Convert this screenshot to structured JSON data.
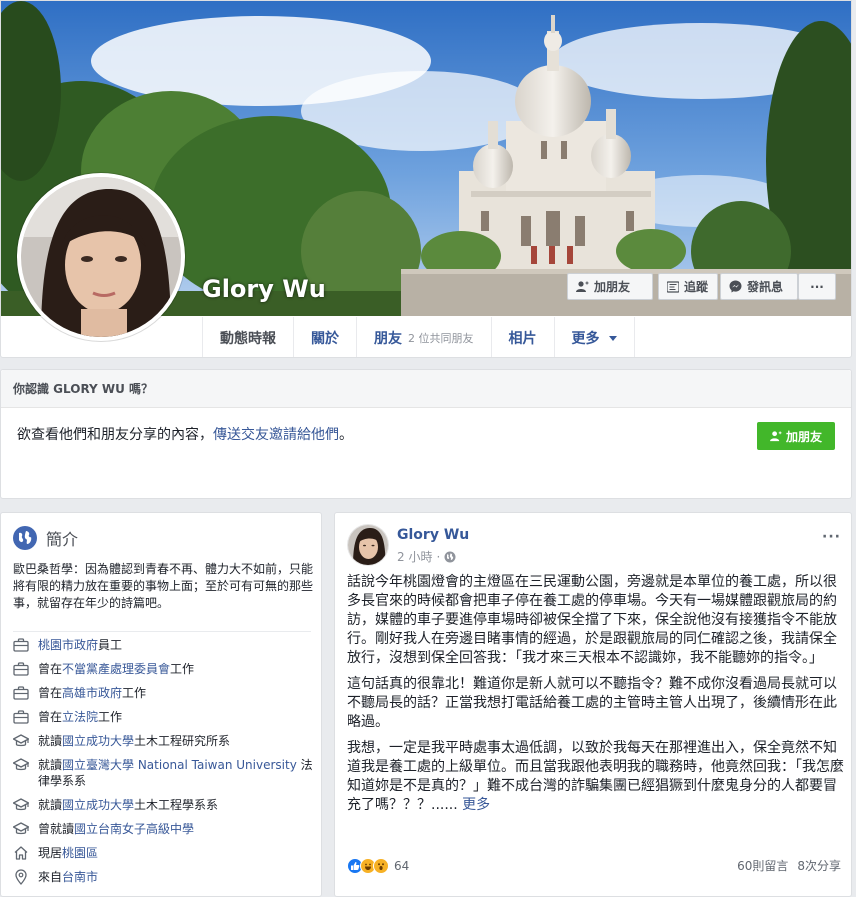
{
  "profile": {
    "name": "Glory Wu",
    "cover_buttons": {
      "add_friend": "加朋友",
      "follow": "追蹤",
      "message": "發訊息",
      "more": "···"
    }
  },
  "nav": {
    "tabs": [
      {
        "label": "動態時報"
      },
      {
        "label": "關於"
      },
      {
        "label": "朋友",
        "sub": "2 位共同朋友"
      },
      {
        "label": "相片"
      },
      {
        "label": "更多"
      }
    ]
  },
  "know_card": {
    "title": "你認識 GLORY WU 嗎？",
    "text": "欲查看他們和朋友分享的內容，",
    "link": "傳送交友邀請給他們",
    "text_end": "。",
    "button": "加朋友"
  },
  "intro": {
    "title": "簡介",
    "bio": "歐巴桑哲學：因為體認到青春不再、體力大不如前，只能將有限的精力放在重要的事物上面；至於可有可無的那些事，就留存在年少的詩篇吧。",
    "items": [
      {
        "icon": "briefcase-icon",
        "pre": "",
        "link": "桃園市政府",
        "post": "員工"
      },
      {
        "icon": "briefcase-icon",
        "pre": "曾在",
        "link": "不當黨產處理委員會",
        "post": "工作"
      },
      {
        "icon": "briefcase-icon",
        "pre": "曾在",
        "link": "高雄市政府",
        "post": "工作"
      },
      {
        "icon": "briefcase-icon",
        "pre": "曾在",
        "link": "立法院",
        "post": "工作"
      },
      {
        "icon": "graduation-cap-icon",
        "pre": "就讀",
        "link": "國立成功大學",
        "post": "土木工程研究所系"
      },
      {
        "icon": "graduation-cap-icon",
        "pre": "就讀",
        "link": "國立臺灣大學 National Taiwan University",
        "post": " 法律學系系"
      },
      {
        "icon": "graduation-cap-icon",
        "pre": "就讀",
        "link": "國立成功大學",
        "post": "土木工程學系系"
      },
      {
        "icon": "graduation-cap-icon",
        "pre": "曾就讀",
        "link": "國立台南女子高級中學",
        "post": ""
      },
      {
        "icon": "home-icon",
        "pre": "現居",
        "link": "桃園區",
        "post": ""
      },
      {
        "icon": "location-pin-icon",
        "pre": "來自",
        "link": "台南市",
        "post": ""
      }
    ]
  },
  "post": {
    "author": "Glory Wu",
    "time": "2 小時",
    "separator": "·",
    "paragraphs": [
      "話說今年桃園燈會的主燈區在三民運動公園，旁邊就是本單位的養工處，所以很多長官來的時候都會把車子停在養工處的停車場。今天有一場媒體跟觀旅局的約訪，媒體的車子要進停車場時卻被保全擋了下來，保全說他沒有接獲指令不能放行。剛好我人在旁邊目睹事情的經過，於是跟觀旅局的同仁確認之後，我請保全放行，沒想到保全回答我：「我才來三天根本不認識妳，我不能聽妳的指令。」",
      "這句話真的很靠北！難道你是新人就可以不聽指令？難不成你沒看過局長就可以不聽局長的話？正當我想打電話給養工處的主管時主管人出現了，後續情形在此略過。",
      "我想，一定是我平時處事太過低調，以致於我每天在那裡進出入，保全竟然不知道我是養工處的上級單位。而且當我跟他表明我的職務時，他竟然回我：「我怎麼知道妳是不是真的？」難不成台灣的詐騙集團已經猖獗到什麼鬼身分的人都要冒充了嗎？？？"
    ],
    "ellipsis": "...... ",
    "see_more": "更多",
    "reaction_count": "64",
    "comments": "60則留言",
    "shares": "8次分享",
    "options": "···"
  },
  "colors": {
    "link": "#385898",
    "nav_link": "#365899",
    "add_friend_green": "#42b72a",
    "page_bg": "#e9ebee",
    "like_blue": "#1877f2",
    "haha_yellow": "#f7b125"
  }
}
